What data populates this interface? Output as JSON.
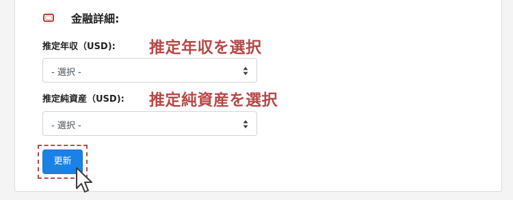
{
  "section": {
    "title": "金融詳細:",
    "icon": "banknote-icon"
  },
  "fields": [
    {
      "label": "推定年収（USD):",
      "annotation": "推定年収を選択",
      "selected": "- 選択 -"
    },
    {
      "label": "推定純資産（USD):",
      "annotation": "推定純資産を選択",
      "selected": "- 選択 -"
    }
  ],
  "update_button": {
    "label": "更新"
  },
  "colors": {
    "accent_red": "#b94747",
    "primary_blue": "#1a82e6"
  }
}
